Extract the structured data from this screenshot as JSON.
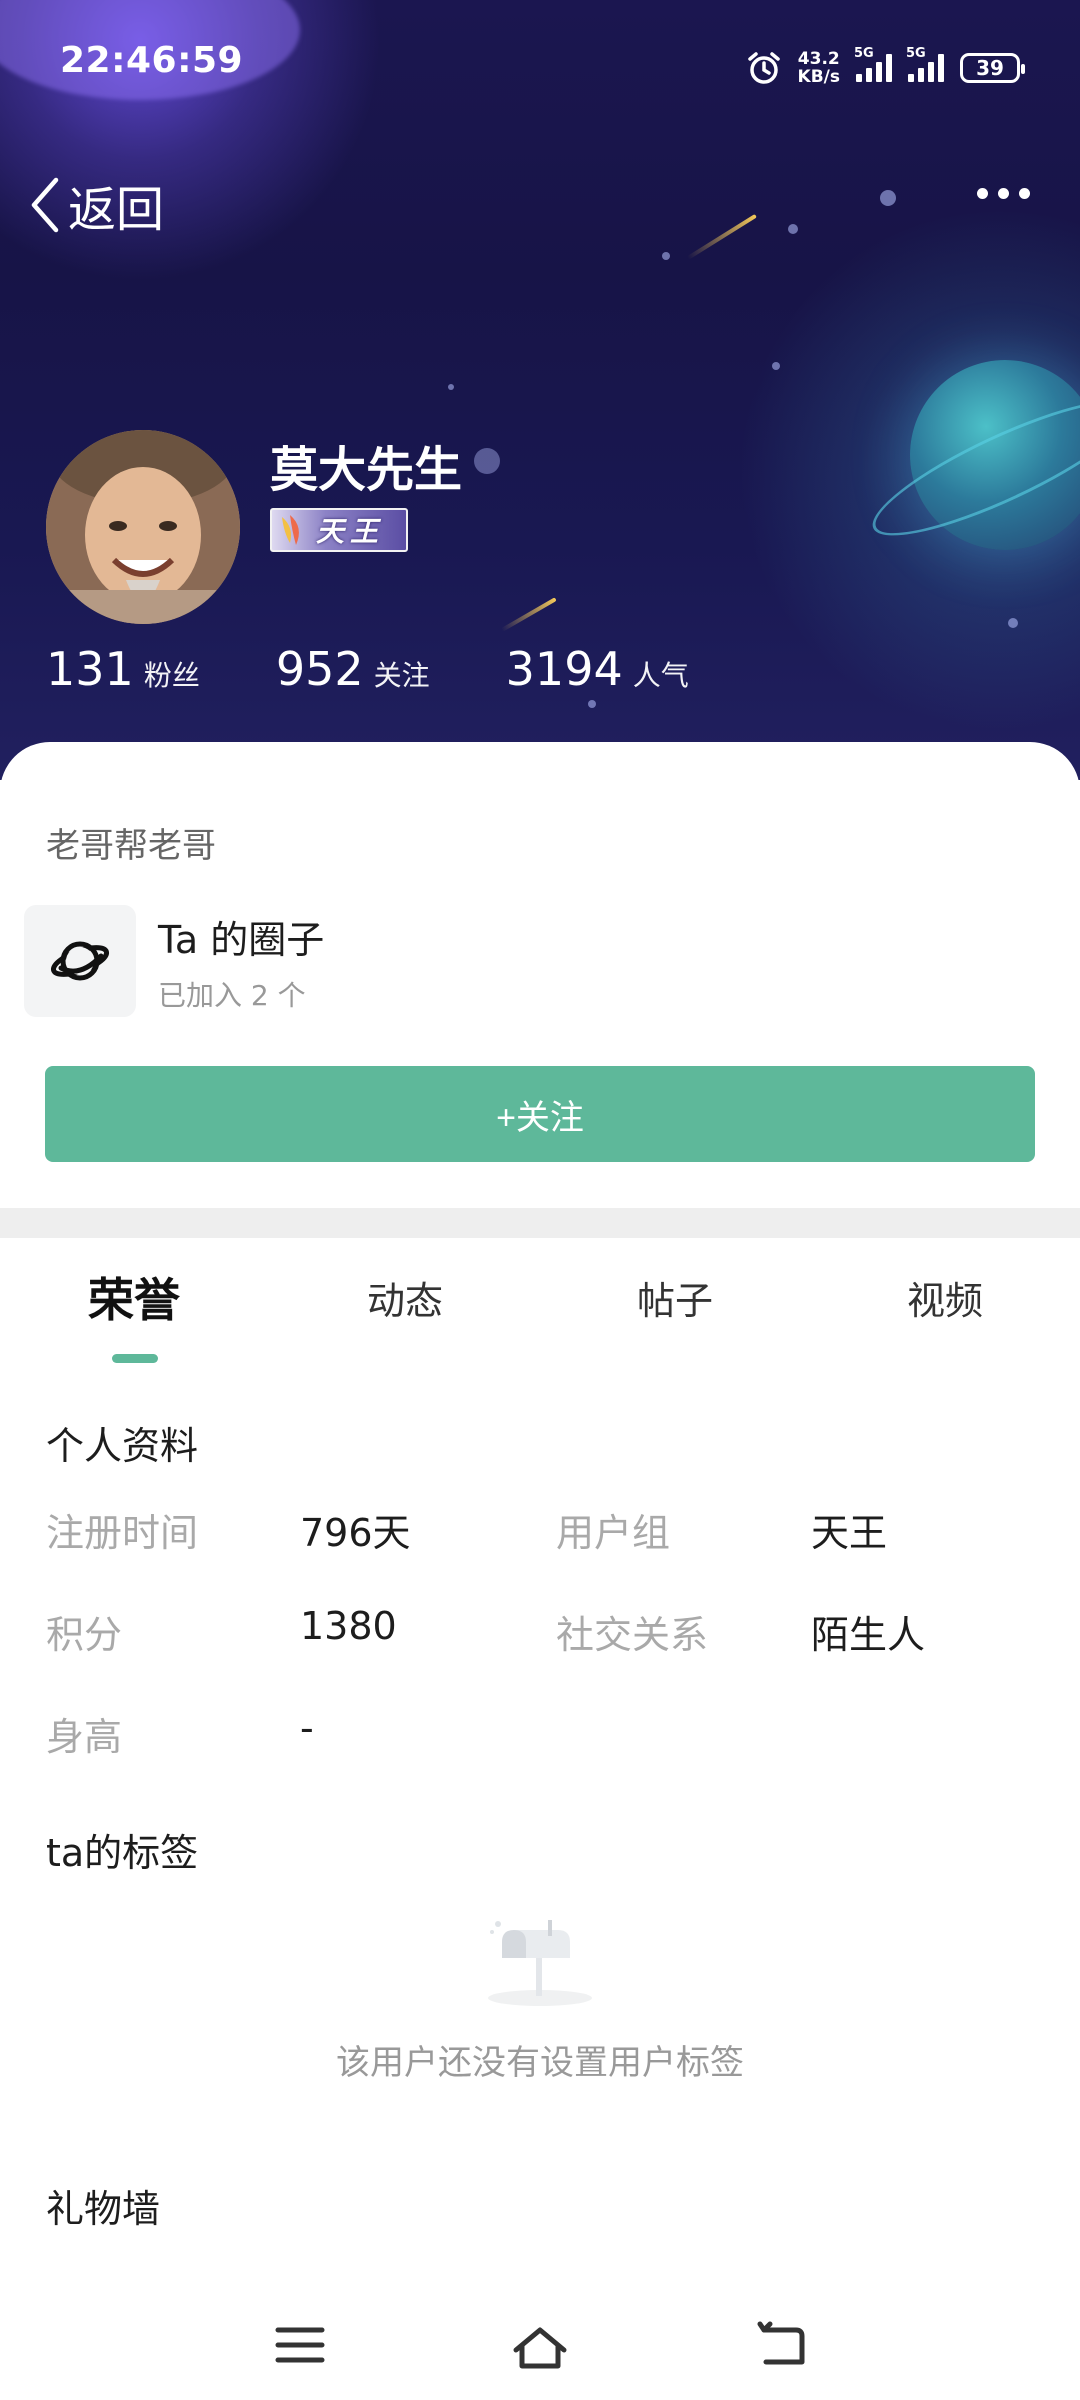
{
  "status_bar": {
    "time": "22:46:59",
    "net_speed_value": "43.2",
    "net_speed_unit": "KB/s",
    "sim1_label": "5G",
    "sim2_label": "5G",
    "battery": "39"
  },
  "header": {
    "back_label": "返回"
  },
  "profile": {
    "username": "莫大先生",
    "badge_text": "天王",
    "stats": [
      {
        "value": "131",
        "label": "粉丝"
      },
      {
        "value": "952",
        "label": "关注"
      },
      {
        "value": "3194",
        "label": "人气"
      }
    ],
    "signature": "老哥帮老哥",
    "circle": {
      "title": "Ta 的圈子",
      "subtitle": "已加入 2 个"
    },
    "follow_button": "+关注"
  },
  "tabs": [
    {
      "label": "荣誉",
      "active": true
    },
    {
      "label": "动态",
      "active": false
    },
    {
      "label": "帖子",
      "active": false
    },
    {
      "label": "视频",
      "active": false
    }
  ],
  "personal_info": {
    "title": "个人资料",
    "fields": [
      {
        "label": "注册时间",
        "value": "796天"
      },
      {
        "label": "用户组",
        "value": "天王"
      },
      {
        "label": "积分",
        "value": "1380"
      },
      {
        "label": "社交关系",
        "value": "陌生人"
      },
      {
        "label": "身高",
        "value": "-"
      }
    ]
  },
  "tags_section": {
    "title": "ta的标签",
    "empty_text": "该用户还没有设置用户标签"
  },
  "gifts_section": {
    "title": "礼物墙"
  },
  "colors": {
    "accent": "#5eb89a",
    "header_bg": "#1b1650"
  },
  "nav_icons": [
    "menu-icon",
    "home-icon",
    "back-icon"
  ]
}
